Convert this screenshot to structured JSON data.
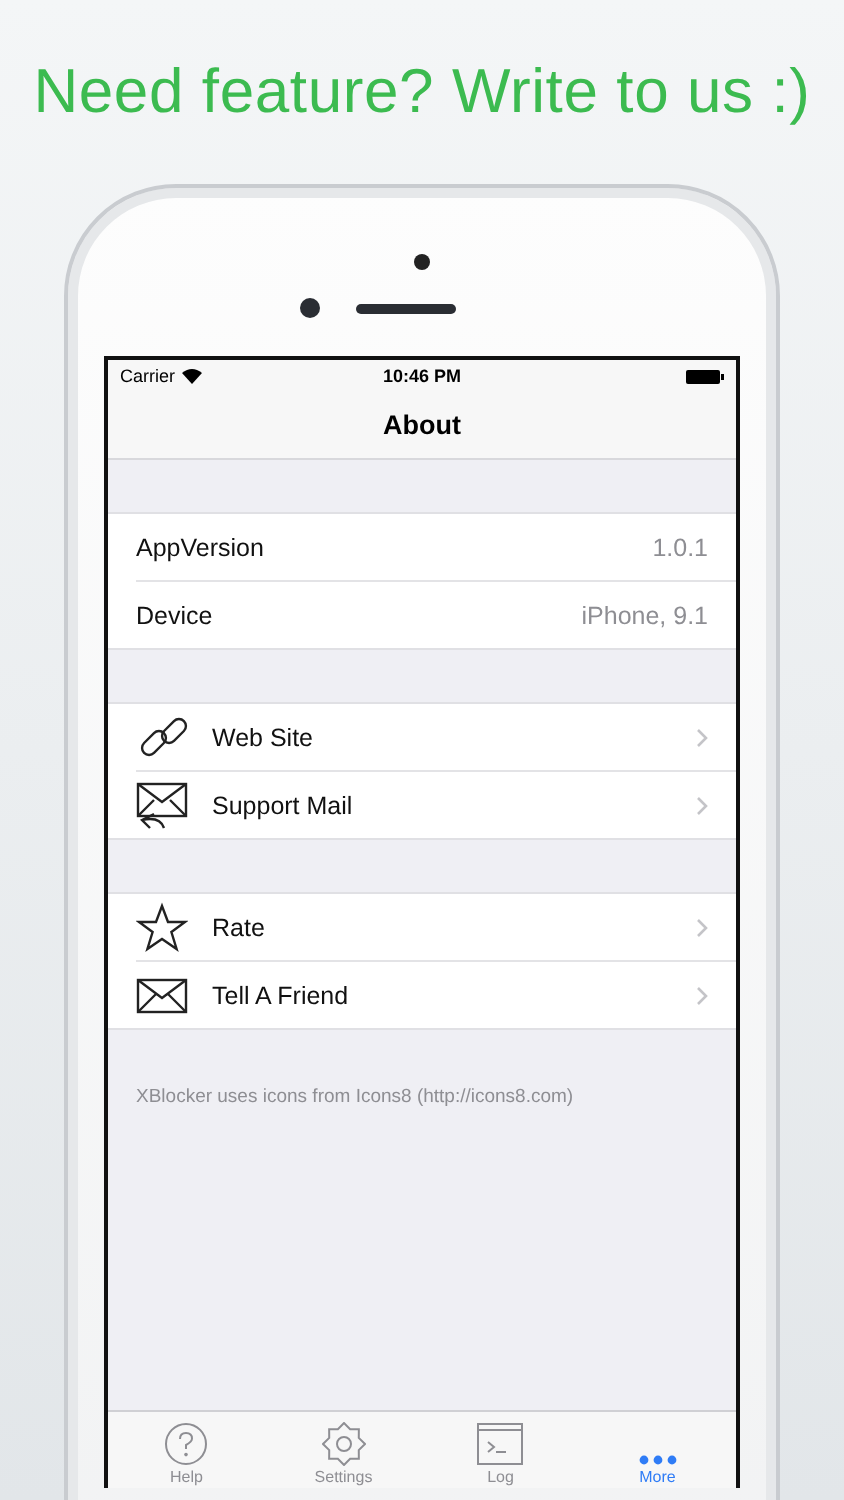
{
  "headline": "Need feature? Write to us :)",
  "status_bar": {
    "carrier": "Carrier",
    "time": "10:46 PM"
  },
  "nav_title": "About",
  "sections": [
    {
      "rows": [
        {
          "kind": "info",
          "label": "AppVersion",
          "value": "1.0.1"
        },
        {
          "kind": "info",
          "label": "Device",
          "value": "iPhone, 9.1"
        }
      ]
    },
    {
      "rows": [
        {
          "kind": "link",
          "label": "Web Site"
        },
        {
          "kind": "mail-reply",
          "label": "Support Mail"
        }
      ]
    },
    {
      "rows": [
        {
          "kind": "star",
          "label": "Rate"
        },
        {
          "kind": "mail",
          "label": "Tell A Friend"
        }
      ]
    }
  ],
  "footer": "XBlocker uses icons from Icons8 (http://icons8.com)",
  "tabs": [
    {
      "kind": "help",
      "label": "Help",
      "selected": false
    },
    {
      "kind": "settings",
      "label": "Settings",
      "selected": false
    },
    {
      "kind": "log",
      "label": "Log",
      "selected": false
    },
    {
      "kind": "more",
      "label": "More",
      "selected": true
    }
  ]
}
